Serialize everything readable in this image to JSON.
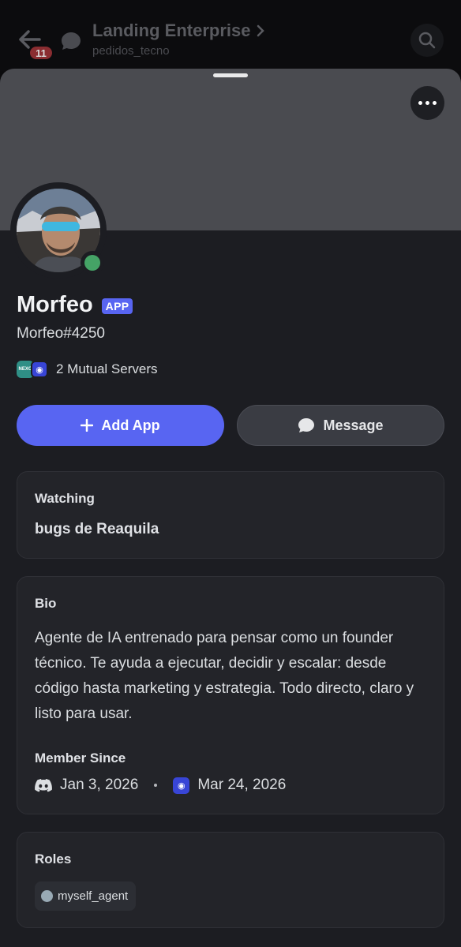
{
  "header": {
    "back_badge": "11",
    "channel_title": "Landing Enterprise",
    "channel_sub": "pedidos_tecno"
  },
  "profile": {
    "name": "Morfeo",
    "tag": "APP",
    "username": "Morfeo#4250",
    "status_color": "#45a366",
    "mutual_servers": "2 Mutual Servers",
    "server1_label": "NEXO"
  },
  "actions": {
    "add_app": "Add App",
    "message": "Message"
  },
  "watching": {
    "title": "Watching",
    "value": "bugs de Reaquila"
  },
  "bio": {
    "title": "Bio",
    "text": "Agente de IA entrenado para pensar como un founder técnico. Te ayuda a ejecutar, decidir y escalar: desde código hasta marketing y estrategia. Todo directo, claro y listo para usar.",
    "member_since_title": "Member Since",
    "discord_date": "Jan 3, 2026",
    "server_date": "Mar 24, 2026"
  },
  "roles": {
    "title": "Roles",
    "items": [
      {
        "label": "myself_agent",
        "color": "#99aab5"
      }
    ]
  },
  "colors": {
    "accent": "#5865f2",
    "background": "#1c1d22",
    "card": "#232429"
  }
}
